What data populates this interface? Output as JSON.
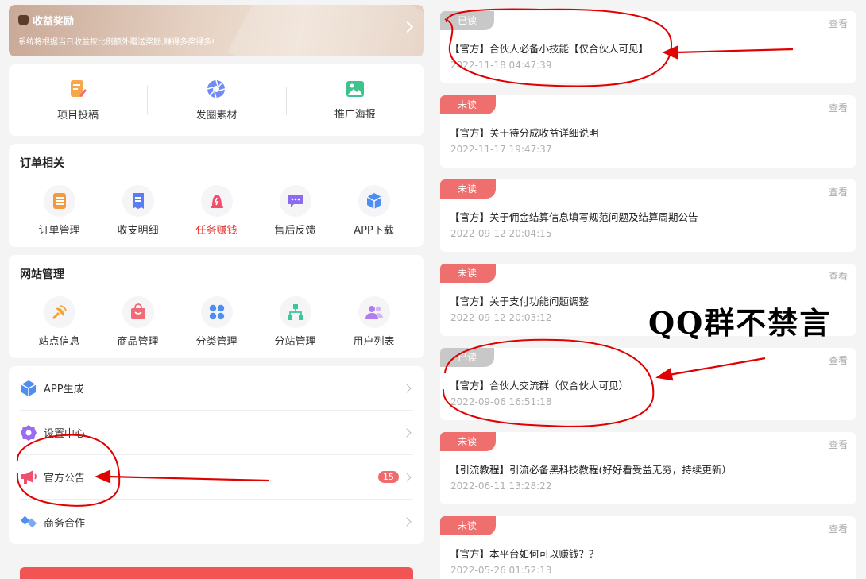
{
  "banner": {
    "title": "收益奖励",
    "subtitle": "系统将根据当日收益按比例额外赠送奖励,赚得多奖得多!"
  },
  "quick_actions": [
    {
      "label": "项目投稿",
      "icon": "document-edit-icon"
    },
    {
      "label": "发圈素材",
      "icon": "aperture-icon"
    },
    {
      "label": "推广海报",
      "icon": "image-icon"
    }
  ],
  "orders": {
    "title": "订单相关",
    "items": [
      {
        "label": "订单管理",
        "icon": "order-list-icon",
        "color": "#f39b3a"
      },
      {
        "label": "收支明细",
        "icon": "receipt-icon",
        "color": "#5b7cf3"
      },
      {
        "label": "任务赚钱",
        "icon": "task-icon",
        "color": "#f0506e"
      },
      {
        "label": "售后反馈",
        "icon": "chat-icon",
        "color": "#8b6cf0"
      },
      {
        "label": "APP下载",
        "icon": "cube-icon",
        "color": "#4f8df0"
      }
    ]
  },
  "site": {
    "title": "网站管理",
    "items": [
      {
        "label": "站点信息",
        "icon": "broadcast-icon",
        "color": "#f3a33a"
      },
      {
        "label": "商品管理",
        "icon": "bag-icon",
        "color": "#f06a78"
      },
      {
        "label": "分类管理",
        "icon": "category-icon",
        "color": "#4f8df0"
      },
      {
        "label": "分站管理",
        "icon": "hierarchy-icon",
        "color": "#3cc79a"
      },
      {
        "label": "用户列表",
        "icon": "users-icon",
        "color": "#b07cf0"
      }
    ]
  },
  "menu": [
    {
      "label": "APP生成",
      "icon": "cube-icon",
      "color": "#4f8df0"
    },
    {
      "label": "设置中心",
      "icon": "gear-icon",
      "color": "#9a6cf0"
    },
    {
      "label": "官方公告",
      "icon": "megaphone-icon",
      "color": "#f0506e",
      "badge": "15"
    },
    {
      "label": "商务合作",
      "icon": "handshake-icon",
      "color": "#4f8df0"
    }
  ],
  "notices": [
    {
      "status": "已读",
      "read": true,
      "view": "查看",
      "title": "【官方】合伙人必备小技能【仅合伙人可见】",
      "time": "2022-11-18 04:47:39"
    },
    {
      "status": "未读",
      "read": false,
      "view": "查看",
      "title": "【官方】关于待分成收益详细说明",
      "time": "2022-11-17 19:47:37"
    },
    {
      "status": "未读",
      "read": false,
      "view": "查看",
      "title": "【官方】关于佣金结算信息填写规范问题及结算周期公告",
      "time": "2022-09-12 20:04:15"
    },
    {
      "status": "未读",
      "read": false,
      "view": "查看",
      "title": "【官方】关于支付功能问题调整",
      "time": "2022-09-12 20:03:12"
    },
    {
      "status": "已读",
      "read": true,
      "view": "查看",
      "title": "【官方】合伙人交流群（仅合伙人可见）",
      "time": "2022-09-06 16:51:18"
    },
    {
      "status": "未读",
      "read": false,
      "view": "查看",
      "title": "【引流教程】引流必备黑科技教程(好好看受益无穷，持续更新）",
      "time": "2022-06-11 13:28:22"
    },
    {
      "status": "未读",
      "read": false,
      "view": "查看",
      "title": "【官方】本平台如何可以赚钱？？",
      "time": "2022-05-26 01:52:13"
    }
  ],
  "annotation_text": "QQ群不禁言",
  "colors": {
    "accent_red": "#ef6e6e",
    "read_gray": "#c8c8c8",
    "annotation_red": "#e00000"
  }
}
